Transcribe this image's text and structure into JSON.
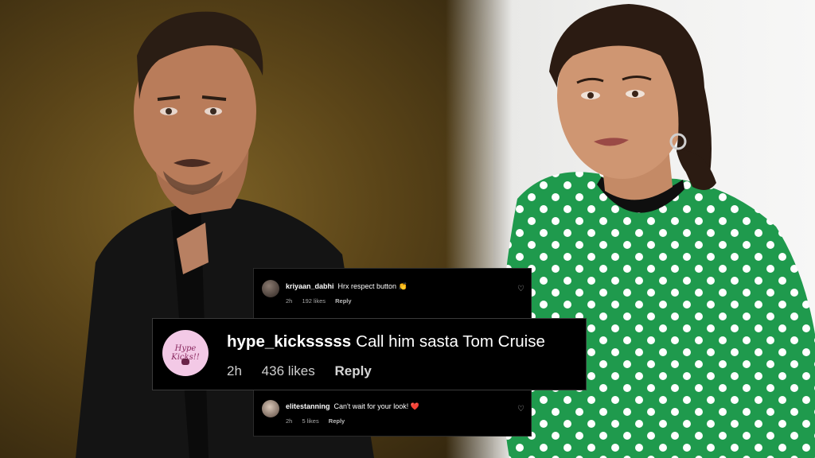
{
  "comments": [
    {
      "username": "kriyaan_dabhi",
      "text": "Hrx respect button",
      "emoji": "👏",
      "time": "2h",
      "likes": "192 likes",
      "reply": "Reply"
    },
    {
      "username": "hype_kicksssss",
      "text": "Call him sasta Tom Cruise",
      "time": "2h",
      "likes": "436 likes",
      "reply": "Reply",
      "avatar_text": "Hype Kicks!!"
    },
    {
      "username": "elitestanning",
      "text": "Can't wait for your look!",
      "emoji": "❤️",
      "time": "2h",
      "likes": "5 likes",
      "reply": "Reply"
    }
  ],
  "icons": {
    "heart": "heart-outline-icon"
  },
  "colors": {
    "left_background": "#5a4418",
    "right_background": "#f2f2f1",
    "dress": "#1f9a4d",
    "comment_bg": "#000000",
    "avatar_pink": "#f3c9e6"
  }
}
